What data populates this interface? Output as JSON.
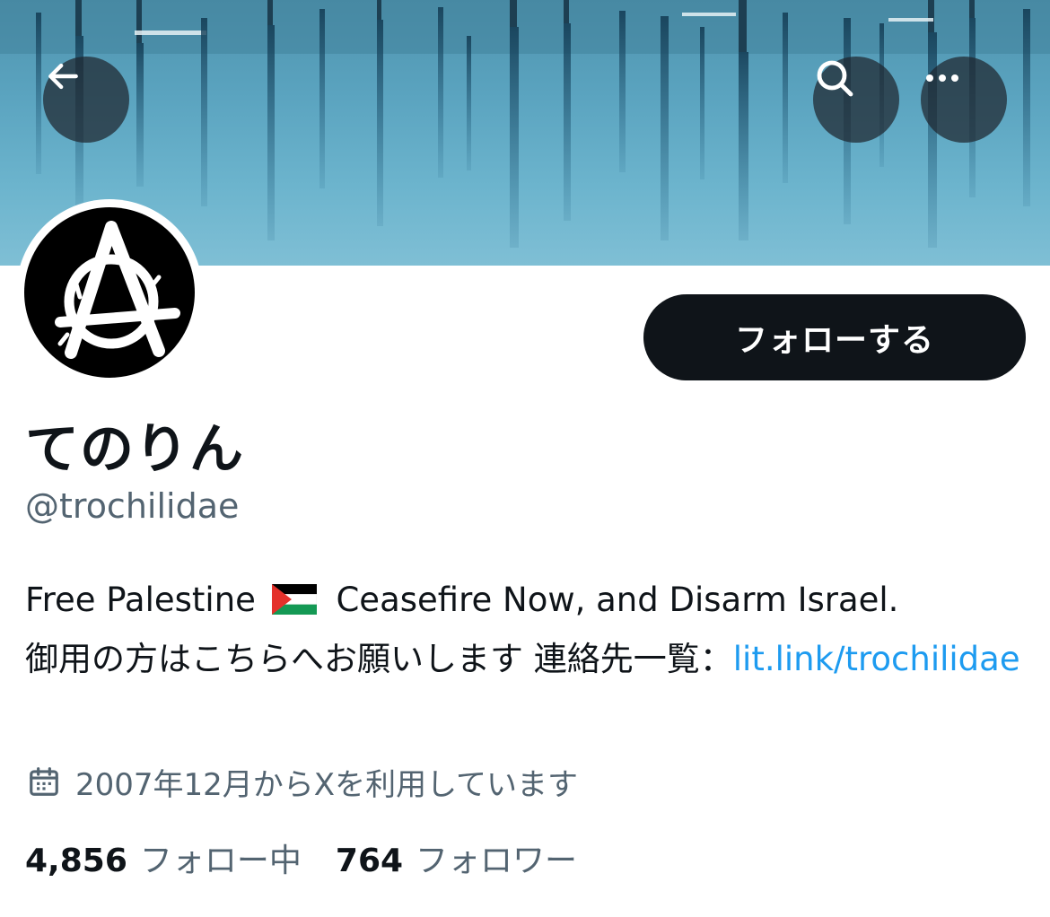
{
  "profile": {
    "display_name": "てのりん",
    "handle": "@trochilidae",
    "follow_label": "フォローする",
    "bio": {
      "text_1": "Free Palestine",
      "flag_icon": "palestine-flag",
      "text_2": "Ceasefire Now, and Disarm Israel.",
      "text_3": "御用の方はこちらへお願いします 連絡先一覧：",
      "link": "lit.link/trochilidae"
    },
    "joined": "2007年12月からXを利用しています",
    "following_count": "4,856",
    "following_label": "フォロー中",
    "followers_count": "764",
    "followers_label": "フォロワー"
  },
  "icons": {
    "back": "arrow-left-icon",
    "search": "search-icon",
    "more": "more-horizontal-icon",
    "calendar": "calendar-icon"
  },
  "colors": {
    "text_primary": "#0f1419",
    "text_secondary": "#536471",
    "link": "#1d9bf0",
    "follow_button_bg": "#0f1419"
  }
}
